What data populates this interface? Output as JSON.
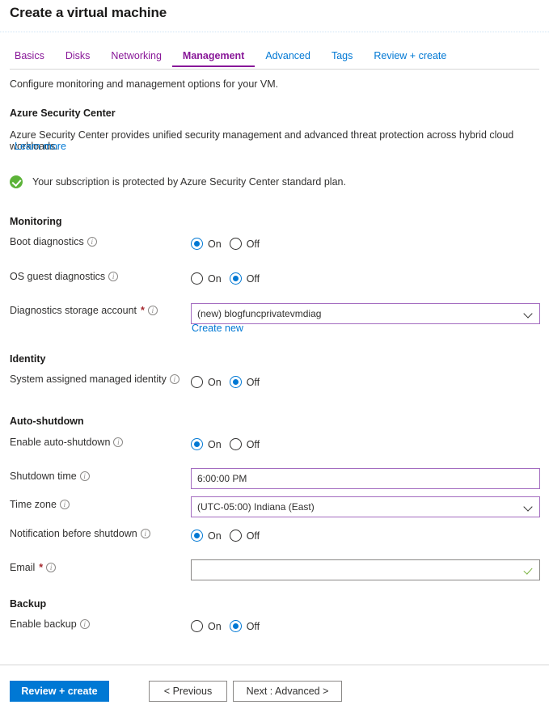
{
  "header": {
    "title": "Create a virtual machine"
  },
  "tabs": [
    {
      "label": "Basics",
      "state": "visited"
    },
    {
      "label": "Disks",
      "state": "visited"
    },
    {
      "label": "Networking",
      "state": "visited"
    },
    {
      "label": "Management",
      "state": "active"
    },
    {
      "label": "Advanced",
      "state": "unvisited"
    },
    {
      "label": "Tags",
      "state": "unvisited"
    },
    {
      "label": "Review + create",
      "state": "unvisited"
    }
  ],
  "intro": "Configure monitoring and management options for your VM.",
  "security_center": {
    "heading": "Azure Security Center",
    "description": "Azure Security Center provides unified security management and advanced threat protection across hybrid cloud workloads.",
    "learn_more": "Learn more",
    "status_text": "Your subscription is protected by Azure Security Center standard plan.",
    "status_icon": "success-check-icon"
  },
  "monitoring": {
    "group_title": "Monitoring",
    "boot_diagnostics": {
      "label": "Boot diagnostics",
      "on": "On",
      "off": "Off",
      "selected": "On"
    },
    "os_guest_diagnostics": {
      "label": "OS guest diagnostics",
      "on": "On",
      "off": "Off",
      "selected": "Off"
    },
    "storage_account": {
      "label": "Diagnostics storage account",
      "required": "*",
      "value": "(new) blogfuncprivatevmdiag",
      "create_new": "Create new",
      "icon": "chevron-down-icon"
    }
  },
  "identity": {
    "group_title": "Identity",
    "system_assigned": {
      "label": "System assigned managed identity",
      "on": "On",
      "off": "Off",
      "selected": "Off"
    }
  },
  "auto_shutdown": {
    "group_title": "Auto-shutdown",
    "enable": {
      "label": "Enable auto-shutdown",
      "on": "On",
      "off": "Off",
      "selected": "On"
    },
    "shutdown_time": {
      "label": "Shutdown time",
      "value": "6:00:00 PM"
    },
    "time_zone": {
      "label": "Time zone",
      "value": "(UTC-05:00) Indiana (East)",
      "icon": "chevron-down-icon"
    },
    "notification": {
      "label": "Notification before shutdown",
      "on": "On",
      "off": "Off",
      "selected": "On"
    },
    "email": {
      "label": "Email",
      "required": "*",
      "value": "",
      "redacted": true,
      "icon": "valid-check-icon"
    }
  },
  "backup": {
    "group_title": "Backup",
    "enable": {
      "label": "Enable backup",
      "on": "On",
      "off": "Off",
      "selected": "Off"
    }
  },
  "footer": {
    "review_create": "Review + create",
    "previous": "< Previous",
    "next": "Next : Advanced >"
  },
  "colors": {
    "accent_blue": "#0078d4",
    "visited_purple": "#881798",
    "field_accent": "#a36cc0",
    "success_green": "#5cb338",
    "required_red": "#a4262c"
  }
}
